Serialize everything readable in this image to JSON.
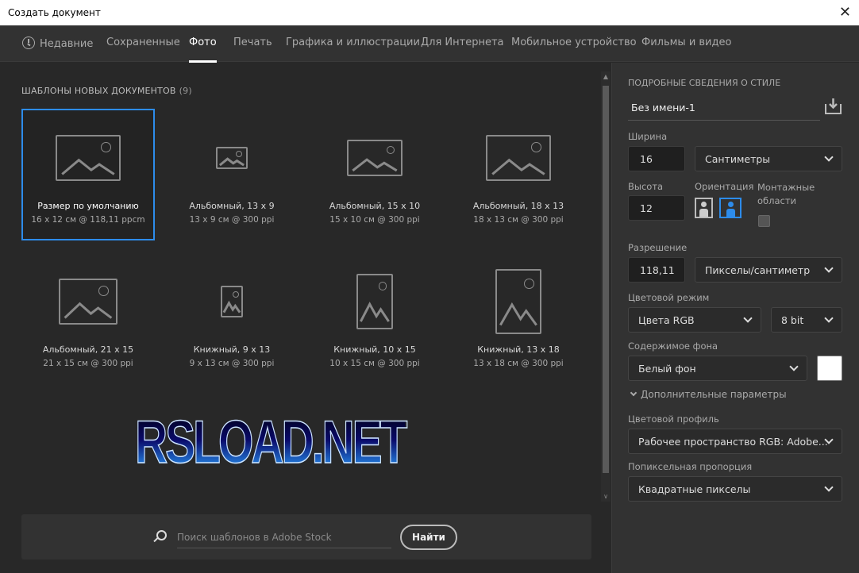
{
  "window": {
    "title": "Создать документ",
    "close_icon": "close-icon"
  },
  "tabs": [
    "Недавние",
    "Сохраненные",
    "Фото",
    "Печать",
    "Графика и иллюстрации",
    "Для Интернета",
    "Мобильное устройство",
    "Фильмы и видео"
  ],
  "active_tab": "Фото",
  "templates": {
    "title": "ШАБЛОНЫ НОВЫХ ДОКУМЕНТОВ",
    "count": "(9)",
    "items": [
      {
        "name": "Размер по умолчанию",
        "size": "16 x 12 см @ 118,11 ppcm",
        "selected": true
      },
      {
        "name": "Альбомный, 13 x 9",
        "size": "13 x 9 см @ 300 ppi"
      },
      {
        "name": "Альбомный, 15 x 10",
        "size": "15 x 10 см @ 300 ppi"
      },
      {
        "name": "Альбомный, 18 x 13",
        "size": "18 x 13 см @ 300 ppi"
      },
      {
        "name": "Альбомный, 21 x 15",
        "size": "21 x 15 см @ 300 ppi"
      },
      {
        "name": "Книжный, 9 x 13",
        "size": "9 x 13 см @ 300 ppi"
      },
      {
        "name": "Книжный, 10 x 15",
        "size": "10 x 15 см @ 300 ppi"
      },
      {
        "name": "Книжный, 13 x 18",
        "size": "13 x 18 см @ 300 ppi"
      }
    ]
  },
  "watermark": "RSLOAD.NET",
  "search": {
    "placeholder": "Поиск шаблонов в Adobe Stock",
    "button": "Найти"
  },
  "details": {
    "title": "ПОДРОБНЫЕ СВЕДЕНИЯ О СТИЛЕ",
    "doc_name": "Без имени-1",
    "width_label": "Ширина",
    "width": "16",
    "width_unit": "Сантиметры",
    "height_label": "Высота",
    "height": "12",
    "orientation_label": "Ориентация",
    "orientation": "landscape",
    "artboards_label": "Монтажные области",
    "resolution_label": "Разрешение",
    "resolution": "118,11",
    "resolution_unit": "Пикселы/сантиметр",
    "color_mode_label": "Цветовой режим",
    "color_mode": "Цвета RGB",
    "bit_depth": "8 bit",
    "background_label": "Содержимое фона",
    "background": "Белый фон",
    "background_color": "#ffffff",
    "advanced": "Дополнительные параметры",
    "profile_label": "Цветовой профиль",
    "profile": "Рабочее пространство RGB: Adobe...",
    "pixel_aspect_label": "Попиксельная пропорция",
    "pixel_aspect": "Квадратные пикселы"
  }
}
